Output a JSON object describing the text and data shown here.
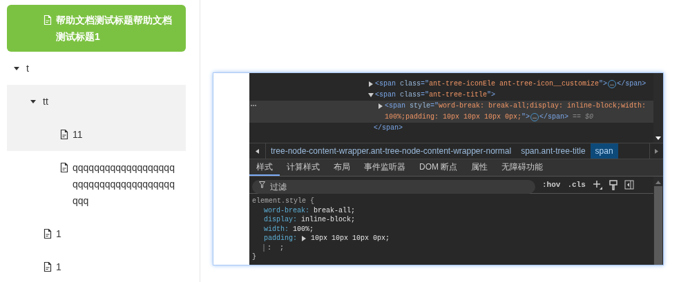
{
  "tree": [
    {
      "title": "帮助文档测试标题帮助文档测试标题1",
      "selected": true
    },
    {
      "title": "t",
      "selected": false,
      "highlighted": false,
      "expanded": true,
      "children": [
        {
          "title": "tt",
          "selected": false,
          "highlighted": true,
          "expanded": true,
          "children": [
            {
              "title": "11",
              "selected": false,
              "highlighted": true
            },
            {
              "title": "qqqqqqqqqqqqqqqqqqqqqqqqqqqqqqqqqqqqqqqqq",
              "selected": false,
              "highlighted": false
            }
          ]
        },
        {
          "title": "1",
          "selected": false,
          "highlighted": false
        },
        {
          "title": "1",
          "selected": false,
          "highlighted": false
        }
      ]
    }
  ],
  "devtools": {
    "dom": [
      {
        "selected": false,
        "expanded": false,
        "parts": [
          {
            "kind": "tag",
            "text": "<span "
          },
          {
            "kind": "attr",
            "text": "class"
          },
          {
            "kind": "tag",
            "text": "=\""
          },
          {
            "kind": "val",
            "text": "ant-tree-iconEle ant-tree-icon__customize"
          },
          {
            "kind": "tag",
            "text": "\">"
          },
          {
            "kind": "ellipsis",
            "text": "…"
          },
          {
            "kind": "tag",
            "text": "</span>"
          }
        ]
      },
      {
        "selected": false,
        "expanded": true,
        "parts": [
          {
            "kind": "tag",
            "text": "<span "
          },
          {
            "kind": "attr",
            "text": "class"
          },
          {
            "kind": "tag",
            "text": "=\""
          },
          {
            "kind": "val",
            "text": "ant-tree-title"
          },
          {
            "kind": "tag",
            "text": "\">"
          }
        ],
        "closing": "</span>",
        "children": [
          {
            "selected": true,
            "expanded": false,
            "parts": [
              {
                "kind": "tag",
                "text": "<span "
              },
              {
                "kind": "attr",
                "text": "style"
              },
              {
                "kind": "tag",
                "text": "=\""
              },
              {
                "kind": "val",
                "text": "word-break: break-all;display: inline-block;width: 100%;padding: 10px 10px 10px 0px;"
              },
              {
                "kind": "tag",
                "text": "\">"
              },
              {
                "kind": "ellipsis",
                "text": "…"
              },
              {
                "kind": "tag",
                "text": "</span>"
              },
              {
                "kind": "dim",
                "text": " == $0"
              }
            ]
          }
        ]
      }
    ],
    "breadcrumbs": [
      {
        "label": "tree-node-content-wrapper.ant-tree-node-content-wrapper-normal",
        "selected": false
      },
      {
        "label": "span.ant-tree-title",
        "selected": false
      },
      {
        "label": "span",
        "selected": true
      }
    ],
    "tabs": [
      {
        "label": "样式",
        "selected": true
      },
      {
        "label": "计算样式",
        "selected": false
      },
      {
        "label": "布局",
        "selected": false
      },
      {
        "label": "事件监听器",
        "selected": false
      },
      {
        "label": "DOM 断点",
        "selected": false
      },
      {
        "label": "属性",
        "selected": false
      },
      {
        "label": "无障碍功能",
        "selected": false
      }
    ],
    "filter": {
      "placeholder": "过滤"
    },
    "toolbar": [
      ":hov",
      ".cls"
    ],
    "rule": {
      "selector": "element.style {",
      "declarations": [
        {
          "property": "word-break:",
          "value": "break-all;",
          "expandable": false
        },
        {
          "property": "display:",
          "value": "inline-block;",
          "expandable": false
        },
        {
          "property": "width:",
          "value": "100%;",
          "expandable": false
        },
        {
          "property": "padding:",
          "value": "10px 10px 10px 0px;",
          "expandable": true
        }
      ],
      "empty_decl": ":  ;",
      "close": "}"
    }
  }
}
